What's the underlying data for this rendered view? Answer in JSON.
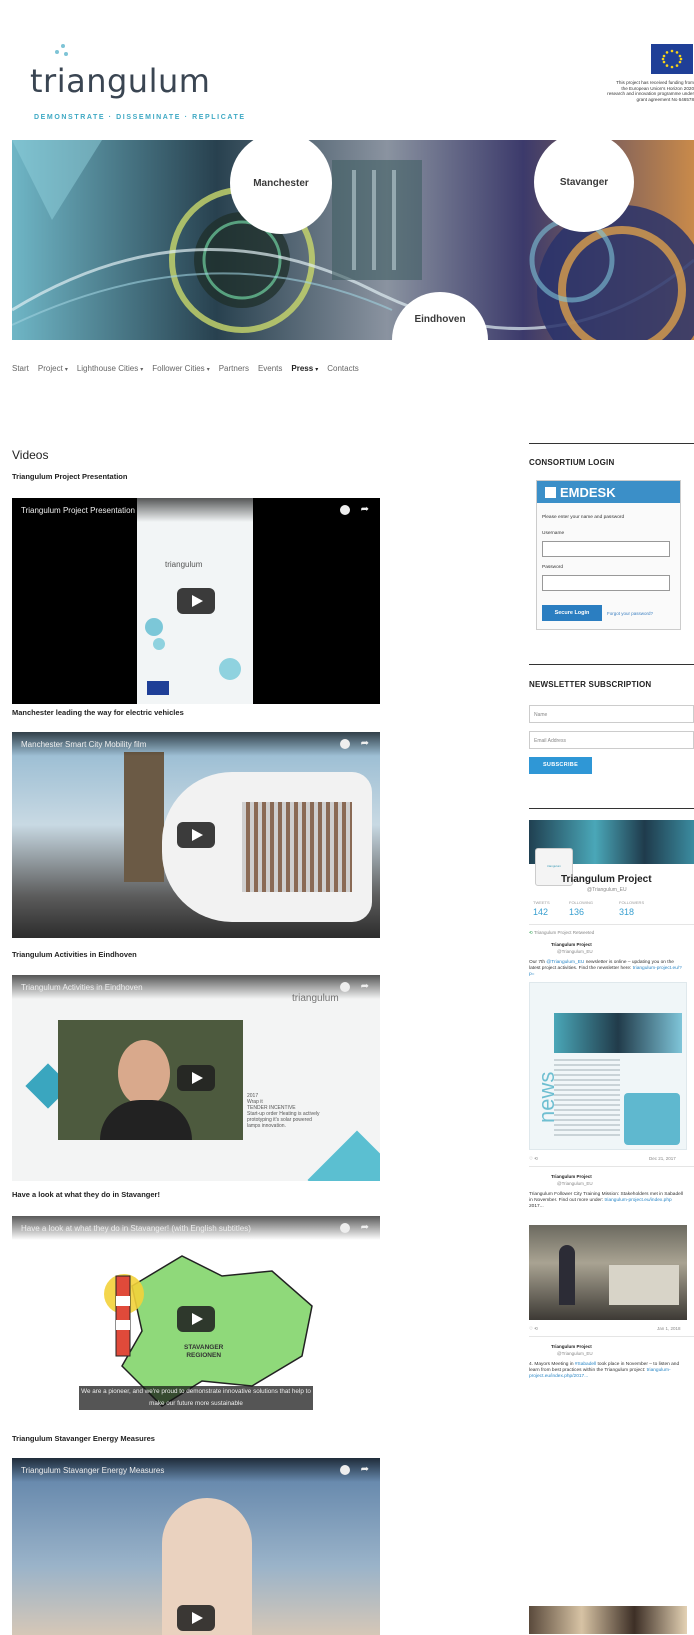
{
  "header": {
    "logo_text": "triangulum",
    "tagline": "DEMONSTRATE · DISSEMINATE · REPLICATE",
    "eu_text": "This project has received funding from\nthe European Union's Horizon 2020\nresearch and innovation programme under\ngrant agreement No 646578"
  },
  "banner": {
    "cities": [
      "Manchester",
      "Stavanger",
      "Eindhoven"
    ]
  },
  "nav": {
    "items": [
      {
        "label": "Start",
        "dropdown": false
      },
      {
        "label": "Project",
        "dropdown": true
      },
      {
        "label": "Lighthouse Cities",
        "dropdown": true
      },
      {
        "label": "Follower Cities",
        "dropdown": true
      },
      {
        "label": "Partners",
        "dropdown": false
      },
      {
        "label": "Events",
        "dropdown": false
      },
      {
        "label": "Press",
        "dropdown": true,
        "active": true
      },
      {
        "label": "Contacts",
        "dropdown": false
      }
    ],
    "caret": "▾"
  },
  "main": {
    "page_title": "Videos",
    "videos": [
      {
        "title": "Triangulum Project Presentation",
        "player_label": "Triangulum Project Presentation"
      },
      {
        "title": "Manchester leading the way for electric vehicles",
        "player_label": "Manchester Smart City Mobility film"
      },
      {
        "title": "Triangulum Activities in Eindhoven",
        "player_label": "Triangulum Activities in Eindhoven"
      },
      {
        "title": "Have a look at what they do in Stavanger!",
        "player_label": "Have a look at what they do in Stavanger! (with English subtitles)",
        "subtitle": "We are a pioneer, and we're proud to demonstrate innovative solutions that help to make our future more sustainable"
      },
      {
        "title": "Triangulum Stavanger Energy Measures",
        "player_label": "Triangulum Stavanger Energy Measures"
      }
    ],
    "video1_overlay_text": "triangulum",
    "video3_overlay_text": "triangulum",
    "video3_card": "2017\nWrap it\nTENDER INCENTIVE\nStart-up order Heating is actively\nprototyping it's solar powered\nlamps innovation.",
    "video4_map_label": "STAVANGER\nREGIONEN"
  },
  "sidebar": {
    "consortium_title": "CONSORTIUM LOGIN",
    "emdesk_logo": "EMDESK",
    "emdesk_intro": "Please enter your name and password",
    "username_label": "Username",
    "password_label": "Password",
    "login_button": "Secure Login",
    "forgot_link": "Forgot your password?",
    "newsletter_title": "NEWSLETTER SUBSCRIPTION",
    "name_placeholder": "Name",
    "email_placeholder": "Email Address",
    "subscribe_button": "SUBSCRIBE",
    "twitter": {
      "avatar_text": "triangulum",
      "name": "Triangulum Project",
      "handle": "@Triangulum_EU",
      "stats": [
        {
          "label": "TWEETS",
          "value": "142"
        },
        {
          "label": "FOLLOWING",
          "value": "136"
        },
        {
          "label": "FOLLOWERS",
          "value": "318"
        }
      ],
      "retweet_note": "Triangulum Project Retweeted",
      "tweets": [
        {
          "author": "Triangulum Project",
          "handle": "@Triangulum_EU",
          "text_pre": "Our 7th ",
          "text_link": "@Triangulum_EU",
          "text_post": " newsletter is online – updating you on the latest project activities. Find the newsletter here: ",
          "url": "triangulum-project.eu/?p=",
          "date": "Dec 21, 2017",
          "newsletter_word": "news"
        },
        {
          "author": "Triangulum Project",
          "handle": "@Triangulum_EU",
          "text_pre": "Triangulum Follower City Training Mission: Stakeholders met in Sabadell in November. Find out more under: ",
          "text_link": "triangulum-project.eu/index.php",
          "text_post": " 2017...",
          "date": "Jan 1, 2018"
        },
        {
          "author": "Triangulum Project",
          "handle": "@Triangulum_EU",
          "text_pre": "4. Mayors Meeting in ",
          "text_link": "#Sabadell",
          "text_post": " took place in November – to listen and learn from best practices within the Triangulum project: ",
          "url": "triangulum-project.eu/index.php/2017..."
        }
      ]
    }
  },
  "colors": {
    "accent": "#3fa9c4",
    "emdesk_blue": "#3b8fc8",
    "subscribe_blue": "#2f97d6",
    "banner_dark": "#2c3e4e"
  }
}
